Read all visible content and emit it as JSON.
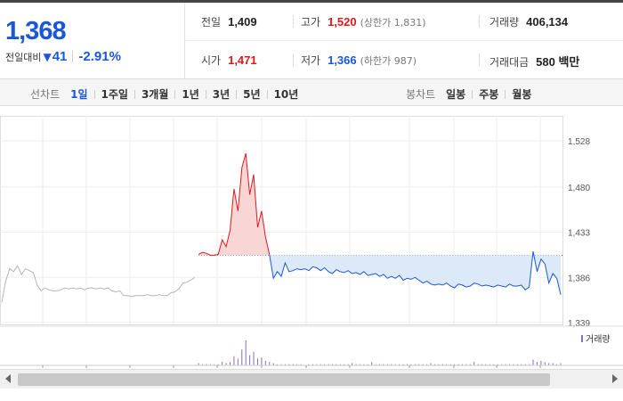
{
  "quote": {
    "now_price": "1,368",
    "change_label": "전일대비",
    "change_icon": "down-triangle-icon",
    "change_amount": "41",
    "change_percent": "-2.91%"
  },
  "info": {
    "prev_label": "전일",
    "prev_value": "1,409",
    "high_label": "고가",
    "high_value": "1,520",
    "upper_limit": "(상한가 1,831)",
    "volume_label": "거래량",
    "volume_value": "406,134",
    "open_label": "시가",
    "open_value": "1,471",
    "low_label": "저가",
    "low_value": "1,366",
    "lower_limit": "(하한가 987)",
    "amount_label": "거래대금",
    "amount_value": "580 백만"
  },
  "period_bar": {
    "line_title": "선차트",
    "line_options": [
      "1일",
      "1주일",
      "3개월",
      "1년",
      "3년",
      "5년",
      "10년"
    ],
    "line_active": "1일",
    "candle_title": "봉차트",
    "candle_options": [
      "일봉",
      "주봉",
      "월봉"
    ]
  },
  "colors": {
    "up": "#e0161b",
    "down": "#1a57d8",
    "prev_day_line": "#b5b5b5",
    "volume": "#8a6cc0"
  },
  "chart_data": {
    "type": "line",
    "y_ticks": [
      "1,528",
      "1,480",
      "1,433",
      "1,386",
      "1,339"
    ],
    "ylim": [
      1339,
      1528
    ],
    "grid": true,
    "baseline": 1409,
    "volume_legend": "거래량",
    "series": [
      {
        "values": [
          1360,
          1382,
          1395,
          1392,
          1398,
          1389,
          1395,
          1393,
          1391,
          1378,
          1372,
          1375,
          1373,
          1372,
          1372,
          1373,
          1375,
          1374,
          1375,
          1374,
          1375,
          1373,
          1375,
          1375,
          1374,
          1375,
          1374,
          1375,
          1372,
          1371,
          1372,
          1367,
          1367,
          1366,
          1367,
          1367,
          1367,
          1368,
          1367,
          1367,
          1368,
          1367,
          1367,
          1370,
          1371,
          1374,
          1380,
          1381,
          1383,
          1386,
          1410,
          1412,
          1411,
          1409,
          1409,
          1410,
          1425,
          1418,
          1435,
          1478,
          1455,
          1500,
          1515,
          1472,
          1493,
          1438,
          1455,
          1428,
          1410,
          1385,
          1392,
          1387,
          1401,
          1392,
          1393,
          1395,
          1394,
          1395,
          1393,
          1397,
          1396,
          1393,
          1396,
          1392,
          1390,
          1394,
          1392,
          1391,
          1393,
          1390,
          1391,
          1389,
          1392,
          1388,
          1389,
          1390,
          1387,
          1389,
          1385,
          1387,
          1385,
          1388,
          1383,
          1385,
          1384,
          1386,
          1383,
          1380,
          1382,
          1379,
          1378,
          1379,
          1378,
          1380,
          1377,
          1375,
          1379,
          1378,
          1376,
          1377,
          1380,
          1379,
          1377,
          1378,
          1377,
          1376,
          1378,
          1377,
          1376,
          1379,
          1377,
          1377,
          1378,
          1373,
          1376,
          1413,
          1392,
          1405,
          1400,
          1380,
          1390,
          1385,
          1368
        ]
      }
    ],
    "volume": [
      0,
      0,
      0,
      0,
      0,
      0,
      0,
      0,
      0,
      0,
      0,
      0,
      0,
      0,
      0,
      0,
      0,
      0,
      0,
      0,
      0,
      0,
      0,
      0,
      0,
      0,
      0,
      0,
      0,
      0,
      0,
      0,
      0,
      0,
      0,
      0,
      0,
      0,
      0,
      0,
      0,
      0,
      0,
      0,
      0,
      0,
      0,
      0,
      0,
      0,
      2,
      1,
      1,
      1,
      1,
      1,
      3,
      2,
      3,
      8,
      6,
      14,
      22,
      9,
      12,
      6,
      7,
      4,
      3,
      2,
      1,
      1,
      1,
      1,
      1,
      1,
      1,
      0,
      1,
      1,
      1,
      1,
      1,
      1,
      1,
      1,
      1,
      1,
      1,
      2,
      1,
      1,
      1,
      1,
      3,
      1,
      1,
      1,
      1,
      1,
      1,
      1,
      1,
      1,
      1,
      1,
      1,
      1,
      1,
      2,
      1,
      1,
      1,
      1,
      1,
      1,
      1,
      1,
      1,
      1,
      3,
      1,
      1,
      1,
      1,
      1,
      1,
      1,
      1,
      1,
      1,
      1,
      1,
      1,
      1,
      5,
      3,
      4,
      3,
      2,
      2,
      1,
      2
    ]
  },
  "scrollbar": {
    "left_icon": "scroll-left-arrow-icon",
    "right_icon": "scroll-right-arrow-icon"
  }
}
